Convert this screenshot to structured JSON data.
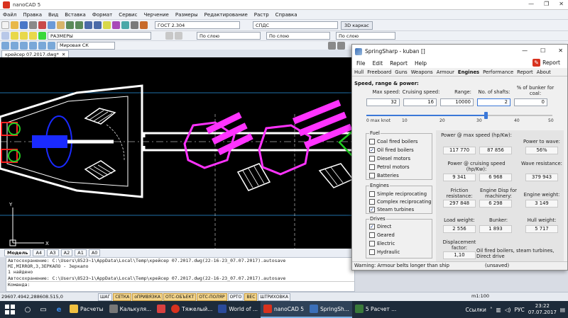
{
  "nanocad": {
    "title": "nanoCAD 5",
    "menu": [
      "Файл",
      "Правка",
      "Вид",
      "Вставка",
      "Формат",
      "Сервис",
      "Черчение",
      "Размеры",
      "Редактирование",
      "Растр",
      "Справка"
    ],
    "toolbar": {
      "style_combo": "ГОСТ 2.304",
      "dim_combo": "СПДС",
      "view_button": "3D каркас",
      "layer_combo": "РАЗМЕРЫ",
      "linetype_combo1": "По слою",
      "linetype_combo2": "По слою",
      "linetype_combo3": "По слою",
      "ucs_combo": "Мировая СК"
    },
    "doc_tab": "крейсер 07.2017.dwg*",
    "layout_tabs": [
      "Модель",
      "A4",
      "A3",
      "A2",
      "A1",
      "A0"
    ],
    "console": {
      "lines": [
        "Автосохранение: C:\\Users\\8523~1\\AppData\\Local\\Temp\\крейсер 07.2017.dwg(22-16-23_07.07.2017).autosave",
        "MI,MIRROR,З,ЗЕРКАЛО - Зеркало",
        "1 найдено",
        "Автосохранение: C:\\Users\\8523~1\\AppData\\Local\\Temp\\крейсер 07.2017.dwg(22-16-23_07.07.2017).autosave"
      ],
      "prompt": "Команда:"
    },
    "status": {
      "coords": "29607.4942,288608.515,0",
      "buttons": [
        {
          "label": "ШАГ",
          "on": false
        },
        {
          "label": "СЕТКА",
          "on": true
        },
        {
          "label": "оПРИВЯЗКА",
          "on": true
        },
        {
          "label": "ОТС-ОБЪЕКТ",
          "on": true
        },
        {
          "label": "ОТС-ПОЛЯР",
          "on": true
        },
        {
          "label": "ОРТО",
          "on": false
        },
        {
          "label": "ВЕС",
          "on": true
        },
        {
          "label": "ШТРИХОВКА",
          "on": false
        }
      ],
      "scale": "m1:100"
    }
  },
  "springsharp": {
    "title": "SpringSharp - kuban []",
    "menu": [
      "File",
      "Edit",
      "Report",
      "Help"
    ],
    "report_button": "Report",
    "tabs": [
      "Hull",
      "Freeboard",
      "Guns",
      "Weapons",
      "Armour",
      "Engines",
      "Performance",
      "Report",
      "About"
    ],
    "active_tab": "Engines",
    "section_title": "Speed, range & power:",
    "inputs": {
      "max_speed": {
        "label": "Max speed:",
        "value": "32"
      },
      "cruising_speed": {
        "label": "Cruising speed:",
        "value": "16"
      },
      "range": {
        "label": "Range:",
        "value": "10000"
      },
      "shafts": {
        "label": "No. of shafts:",
        "value": "2"
      },
      "bunker": {
        "label": "% of bunker for coal:",
        "value": "0"
      }
    },
    "slider": {
      "ticks": [
        "0 max knot",
        "10",
        "20",
        "30",
        "40",
        "50"
      ],
      "value": 32,
      "max": 50
    },
    "fuel": {
      "title": "Fuel",
      "items": [
        {
          "label": "Coal fired boilers",
          "checked": false
        },
        {
          "label": "Oil fired boilers",
          "checked": true
        },
        {
          "label": "Diesel motors",
          "checked": false
        },
        {
          "label": "Petrol motors",
          "checked": false
        },
        {
          "label": "Batteries",
          "checked": false
        }
      ]
    },
    "engines": {
      "title": "Engines",
      "items": [
        {
          "label": "Simple reciprocating",
          "checked": false
        },
        {
          "label": "Complex reciprocating",
          "checked": false
        },
        {
          "label": "Steam turbines",
          "checked": true
        }
      ]
    },
    "drives": {
      "title": "Drives",
      "items": [
        {
          "label": "Direct",
          "checked": true
        },
        {
          "label": "Geared",
          "checked": false
        },
        {
          "label": "Electric",
          "checked": false
        },
        {
          "label": "Hydraulic",
          "checked": false
        }
      ]
    },
    "results": {
      "power_max_label": "Power @ max speed (hp/Kw):",
      "power_max_hp": "117 770",
      "power_max_kw": "87 856",
      "power_wave_label": "Power to wave:",
      "power_wave": "56%",
      "power_cruise_label": "Power @ cruising speed (hp/Kw):",
      "power_cruise_hp": "9 341",
      "power_cruise_kw": "6 968",
      "wave_res_label": "Wave resistance:",
      "wave_res": "379 943",
      "friction_label": "Friction resistance:",
      "friction": "297 848",
      "disp_label": "Engine Disp for machinery:",
      "disp": "6 298",
      "eng_weight_label": "Engine weight:",
      "eng_weight": "3 149",
      "load_label": "Load weight:",
      "load": "2 556",
      "bunker_label": "Bunker:",
      "bunker": "1 893",
      "hull_label": "Hull weight:",
      "hull": "5 717",
      "disp_factor_label": "Displacement factor:",
      "disp_factor": "1,10",
      "summary": "Oil fired boilers, steam turbines, Direct drive"
    },
    "status_warning": "Warning: Armour belts longer than ship",
    "status_units": "(unsaved)"
  },
  "taskbar": {
    "apps": [
      {
        "label": "Расчеты",
        "color": "#f0c040"
      },
      {
        "label": "Калькуля...",
        "color": "#777"
      },
      {
        "label": "",
        "color": "#d84040"
      },
      {
        "label": "Тяжелый...",
        "color": "#d8321e"
      },
      {
        "label": "World of ...",
        "color": "#2a4a9a"
      },
      {
        "label": "nanoCAD 5",
        "color": "#d8321e"
      },
      {
        "label": "SpringSh...",
        "color": "#3b6fb8"
      },
      {
        "label": "5 Расчет ...",
        "color": "#3a7a3a"
      }
    ],
    "tray_links": "Ссылки",
    "lang": "РУС",
    "time": "23:22",
    "date": "07.07.2017"
  },
  "colors": {
    "canvas": "#000000",
    "magenta": "#ff33ff",
    "blue": "#1a2aff",
    "green": "#22cc22",
    "red": "#ff2222",
    "accent": "#3b78d8"
  }
}
